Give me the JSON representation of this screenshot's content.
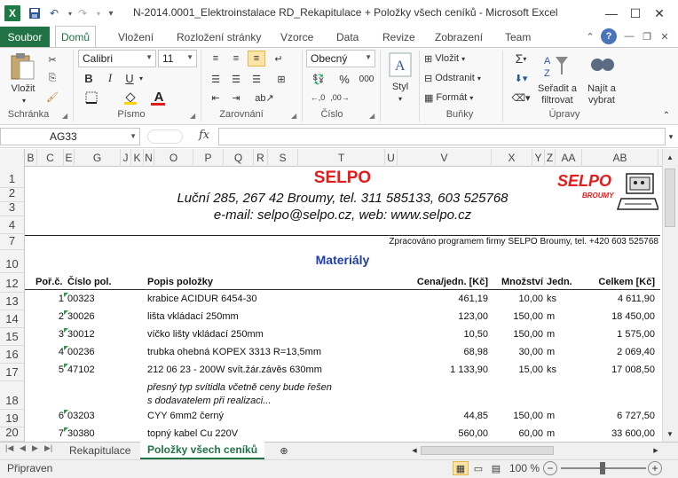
{
  "window": {
    "title": "N-2014.0001_Elektroinstalace RD_Rekapitulace + Položky všech ceníků  -  Microsoft Excel",
    "minimize": "—",
    "maximize": "☐",
    "close": "✕"
  },
  "ribbon_tabs": [
    "Soubor",
    "Domů",
    "Vložení",
    "Rozložení stránky",
    "Vzorce",
    "Data",
    "Revize",
    "Zobrazení",
    "Team"
  ],
  "ribbon": {
    "clipboard": {
      "paste": "Vložit",
      "label": "Schránka"
    },
    "font": {
      "name": "Calibri",
      "size": "11",
      "label": "Písmo",
      "bold": "B",
      "italic": "I",
      "underline": "U"
    },
    "alignment": {
      "label": "Zarovnání"
    },
    "number": {
      "format": "Obecný",
      "label": "Číslo",
      "percent": "%",
      "thousands": "000"
    },
    "styles": {
      "label": "Styl"
    },
    "cells": {
      "insert": "Vložit",
      "delete": "Odstranit",
      "format": "Formát",
      "label": "Buňky"
    },
    "editing": {
      "sum": "Σ",
      "sort": "Seřadit a filtrovat",
      "find": "Najít a vybrat",
      "label": "Úpravy"
    }
  },
  "formula_bar": {
    "name_box": "AG33",
    "fx": "fx",
    "value": ""
  },
  "columns": [
    "B",
    "C",
    "E",
    "G",
    "J",
    "K",
    "N",
    "O",
    "P",
    "Q",
    "R",
    "S",
    "T",
    "U",
    "V",
    "X",
    "Y",
    "Z",
    "AA",
    "AB"
  ],
  "rows": [
    "1",
    "2",
    "3",
    "4",
    "7",
    "10",
    "12",
    "13",
    "14",
    "15",
    "16",
    "17",
    "18",
    "19",
    "20"
  ],
  "header": {
    "company": "SELPO",
    "address": "Luční 285, 267 42 Broumy, tel. 311 585133, 603 525768",
    "contact": "e-mail: selpo@selpo.cz, web: www.selpo.cz",
    "processed": "Zpracováno programem firmy SELPO Broumy, tel. +420 603 525768",
    "logo_text": "SELPO",
    "logo_sub": "BROUMY"
  },
  "section_title": "Materiály",
  "table": {
    "headers": {
      "no": "Poř.č.",
      "code": "Číslo pol.",
      "desc": "Popis položky",
      "price": "Cena/jedn. [Kč]",
      "qty": "Množství",
      "unit": "Jedn.",
      "total": "Celkem [Kč]"
    },
    "rows": [
      {
        "no": "1",
        "code": "00323",
        "desc": "krabice ACIDUR 6454-30",
        "price": "461,19",
        "qty": "10,00",
        "unit": "ks",
        "total": "4 611,90"
      },
      {
        "no": "2",
        "code": "30026",
        "desc": "lišta vkládací 250mm",
        "price": "123,00",
        "qty": "150,00",
        "unit": "m",
        "total": "18 450,00"
      },
      {
        "no": "3",
        "code": "30012",
        "desc": "víčko lišty vkládací 250mm",
        "price": "10,50",
        "qty": "150,00",
        "unit": "m",
        "total": "1 575,00"
      },
      {
        "no": "4",
        "code": "00236",
        "desc": "trubka ohebná KOPEX 3313 R=13,5mm",
        "price": "68,98",
        "qty": "30,00",
        "unit": "m",
        "total": "2 069,40"
      },
      {
        "no": "5",
        "code": "47102",
        "desc": "212 06 23 - 200W svít.žár.závěs 630mm",
        "price": "1 133,90",
        "qty": "15,00",
        "unit": "ks",
        "total": "17 008,50"
      },
      {
        "no": "6",
        "code": "03203",
        "desc": "CYY  6mm2 černý",
        "price": "44,85",
        "qty": "150,00",
        "unit": "m",
        "total": "6 727,50"
      },
      {
        "no": "7",
        "code": "30380",
        "desc": "topný kabel Cu 220V",
        "price": "560,00",
        "qty": "60,00",
        "unit": "m",
        "total": "33 600,00"
      }
    ],
    "note_line1": "přesný typ svítidla včetně ceny bude řešen",
    "note_line2": "s  dodavatelem při realizaci..."
  },
  "sheet_tabs": [
    "Rekapitulace",
    "Položky všech ceníků"
  ],
  "status": {
    "ready": "Připraven",
    "zoom": "100 %"
  },
  "colors": {
    "excel_green": "#217346",
    "selpo_red": "#e21b1b",
    "title_blue": "#1f3fa6"
  }
}
